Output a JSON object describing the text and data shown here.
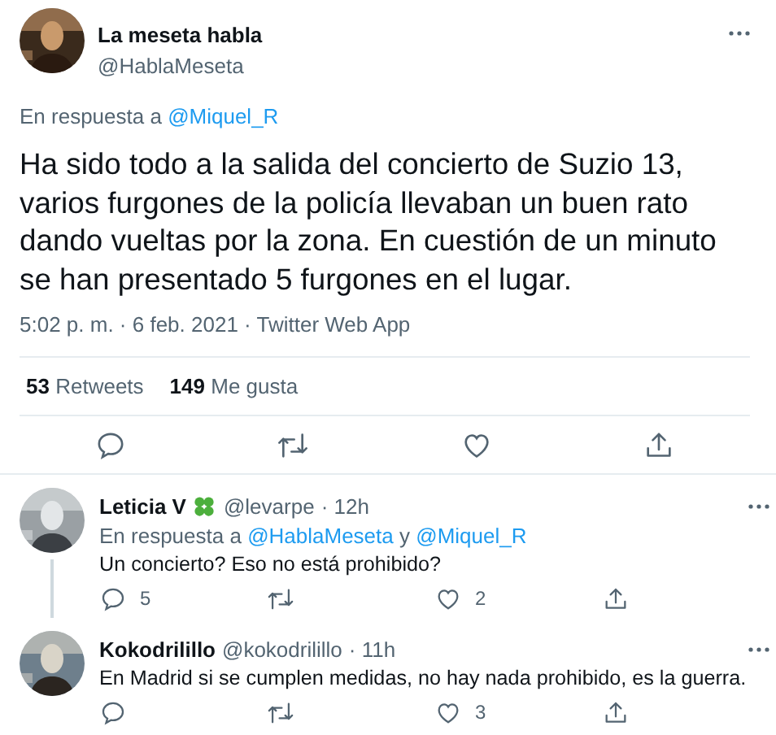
{
  "tweet": {
    "name": "La meseta habla",
    "handle": "@HablaMeseta",
    "reply_to": {
      "prefix": "En respuesta a",
      "links": [
        "@Miquel_R"
      ]
    },
    "text": "Ha sido todo a la salida del concierto de Suzio 13, varios furgones de la policía llevaban un buen rato dando vueltas por la zona. En cuestión de un minuto se han presentado 5 furgones en el lugar.",
    "meta": "5:02 p. m. · 6 feb. 2021 · Twitter Web App",
    "stats": [
      {
        "count": "53",
        "label": "Retweets"
      },
      {
        "count": "149",
        "label": "Me gusta"
      }
    ]
  },
  "replies": [
    {
      "name": "Leticia V",
      "emoji_badge": true,
      "handle": "@levarpe",
      "time": "· 12h",
      "reply_to": {
        "prefix": "En respuesta a",
        "links": [
          "@HablaMeseta",
          "@Miquel_R"
        ],
        "joiner": "y"
      },
      "text": "Un concierto? Eso no está prohibido?",
      "replies": "5",
      "likes": "2"
    },
    {
      "name": "Kokodrilillo",
      "handle": "@kokodrilillo",
      "time": "· 11h",
      "text": "En Madrid si se cumplen medidas, no hay nada prohibido, es la guerra.",
      "likes": "3"
    }
  ]
}
